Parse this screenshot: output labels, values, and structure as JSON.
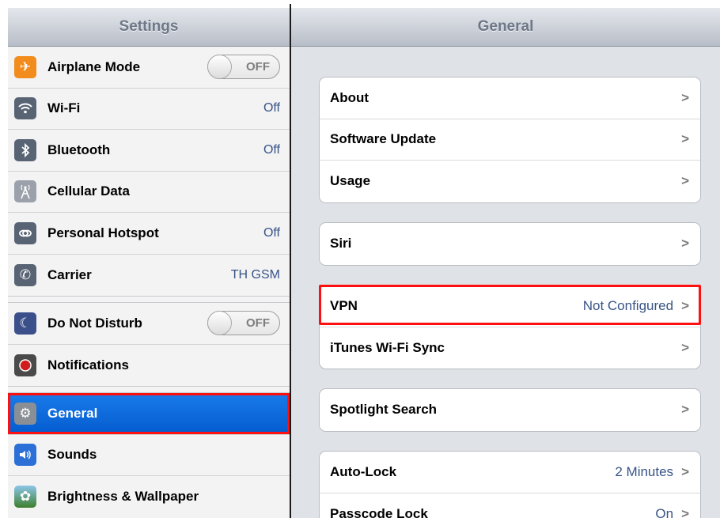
{
  "left": {
    "title": "Settings",
    "groups": [
      [
        {
          "label": "Airplane Mode",
          "icon": "airplane-icon",
          "icon_color": "#f28c1c",
          "toggle": "OFF"
        },
        {
          "label": "Wi-Fi",
          "icon": "wifi-icon",
          "icon_color": "#586374",
          "value": "Off"
        },
        {
          "label": "Bluetooth",
          "icon": "bluetooth-icon",
          "icon_color": "#586374",
          "value": "Off"
        },
        {
          "label": "Cellular Data",
          "icon": "antenna-icon",
          "icon_color": "#9aa1ab"
        },
        {
          "label": "Personal Hotspot",
          "icon": "hotspot-icon",
          "icon_color": "#586374",
          "value": "Off"
        },
        {
          "label": "Carrier",
          "icon": "phone-icon",
          "icon_color": "#586374",
          "value": "TH GSM"
        }
      ],
      [
        {
          "label": "Do Not Disturb",
          "icon": "moon-icon",
          "icon_color": "#3b4f8a",
          "toggle": "OFF"
        },
        {
          "label": "Notifications",
          "icon": "notifications-icon",
          "icon_color": "#d01c1c"
        }
      ],
      [
        {
          "label": "General",
          "icon": "gear-icon",
          "icon_color": "#8a8f96",
          "selected": true
        },
        {
          "label": "Sounds",
          "icon": "speaker-icon",
          "icon_color": "#2c6fd6"
        },
        {
          "label": "Brightness & Wallpaper",
          "icon": "flower-icon",
          "icon_color": "#5b8b3c"
        }
      ]
    ]
  },
  "right": {
    "title": "General",
    "groups": [
      [
        {
          "label": "About"
        },
        {
          "label": "Software Update"
        },
        {
          "label": "Usage"
        }
      ],
      [
        {
          "label": "Siri"
        }
      ],
      [
        {
          "label": "VPN",
          "value": "Not Configured",
          "highlight": true
        },
        {
          "label": "iTunes Wi-Fi Sync"
        }
      ],
      [
        {
          "label": "Spotlight Search"
        }
      ],
      [
        {
          "label": "Auto-Lock",
          "value": "2 Minutes"
        },
        {
          "label": "Passcode Lock",
          "value": "On"
        }
      ]
    ]
  },
  "chevron": ">"
}
